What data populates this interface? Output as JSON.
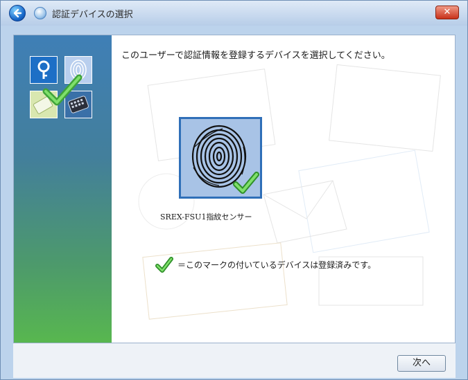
{
  "window": {
    "title": "認証デバイスの選択",
    "close_label": "✕"
  },
  "main": {
    "instruction": "このユーザーで認証情報を登録するデバイスを選択してください。",
    "device": {
      "label": "SREX-FSU1指紋センサー",
      "registered": true
    },
    "note": "＝このマークの付いているデバイスは登録済みです。"
  },
  "footer": {
    "next_label": "次へ"
  },
  "colors": {
    "accent": "#2f6fb8",
    "check": "#49b93a",
    "panel_top": "#3f7fb6",
    "panel_bottom": "#58b74f"
  },
  "icons": [
    "back-arrow-icon",
    "window-icon",
    "close-icon",
    "key-icon",
    "fingerprint-icon",
    "card-icon",
    "keypad-icon",
    "checkmark-icon"
  ]
}
